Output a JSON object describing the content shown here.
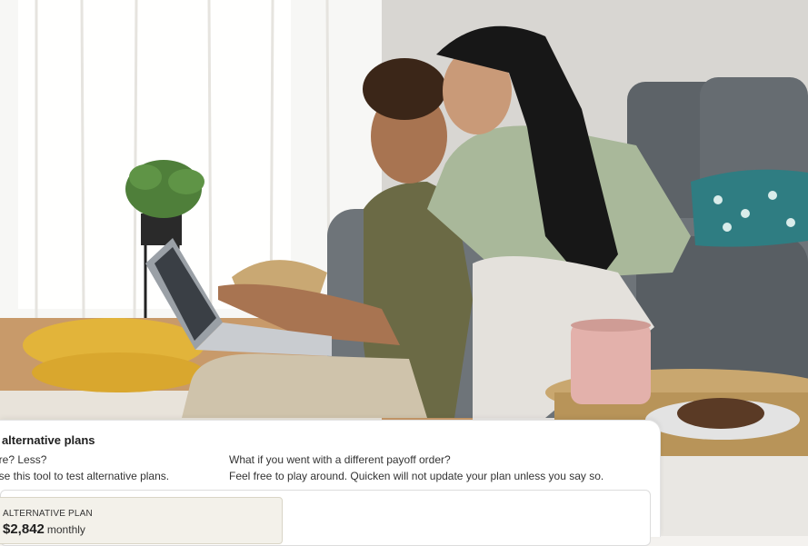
{
  "photo": {
    "description_icon": "lifestyle-photo"
  },
  "panel": {
    "title": "t alternative plans",
    "left_line1": "ore? Less?",
    "left_line2": "use this tool to test alternative plans.",
    "right_line1": "What if you went with a different payoff order?",
    "right_line2": "Feel free to play around. Quicken will not update your plan unless you say so.",
    "alt_plan": {
      "label": "ALTERNATIVE PLAN",
      "amount": "$2,842",
      "period": "monthly"
    }
  },
  "colors": {
    "panel_bg": "#ffffff",
    "card_bg": "#f3f1ea",
    "text": "#1f1f1f"
  }
}
